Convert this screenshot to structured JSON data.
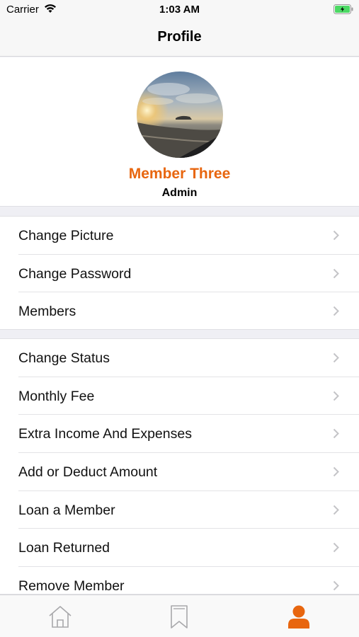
{
  "status_bar": {
    "carrier": "Carrier",
    "time": "1:03 AM"
  },
  "nav": {
    "title": "Profile"
  },
  "profile": {
    "name": "Member Three",
    "role": "Admin"
  },
  "colors": {
    "accent": "#e8660f",
    "chevron": "#c4c4c7"
  },
  "menu_group_1": [
    {
      "label": "Change Picture"
    },
    {
      "label": "Change Password"
    },
    {
      "label": "Members"
    }
  ],
  "menu_group_2": [
    {
      "label": "Change Status"
    },
    {
      "label": "Monthly Fee"
    },
    {
      "label": "Extra Income And Expenses"
    },
    {
      "label": "Add or Deduct Amount"
    },
    {
      "label": "Loan a Member"
    },
    {
      "label": "Loan Returned"
    },
    {
      "label": "Remove Member"
    }
  ],
  "tabs": [
    {
      "icon": "home-icon",
      "active": false
    },
    {
      "icon": "bookmark-icon",
      "active": false
    },
    {
      "icon": "person-icon",
      "active": true
    }
  ]
}
